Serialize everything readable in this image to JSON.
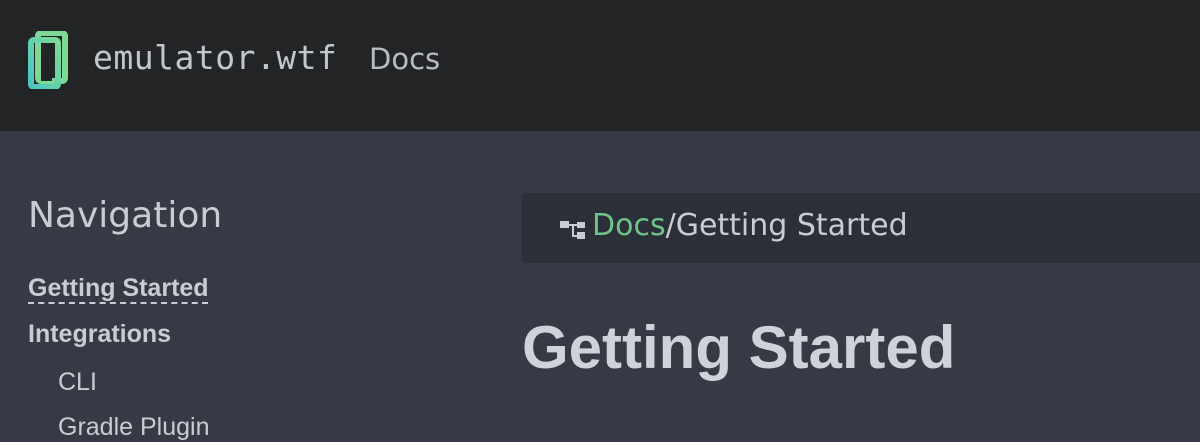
{
  "header": {
    "brand": "emulator.wtf",
    "section": "Docs",
    "logo_icon": "phone-outline-logo",
    "logo_colors": [
      "#4cc6c3",
      "#7ed996"
    ]
  },
  "nav": {
    "heading": "Navigation",
    "items": [
      {
        "label": "Getting Started",
        "current": true
      },
      {
        "label": "Integrations",
        "type": "section"
      },
      {
        "label": "CLI",
        "type": "child"
      },
      {
        "label": "Gradle Plugin",
        "type": "child"
      }
    ]
  },
  "breadcrumb": {
    "icon": "sitemap-icon",
    "root": "Docs",
    "separator": "/",
    "current": "Getting Started"
  },
  "page": {
    "title": "Getting Started"
  },
  "colors": {
    "header_bg": "#232426",
    "content_bg": "#353a44",
    "breadcrumb_bg": "#2b2f37",
    "link": "#6fc388",
    "text": "#c9ccd2"
  }
}
